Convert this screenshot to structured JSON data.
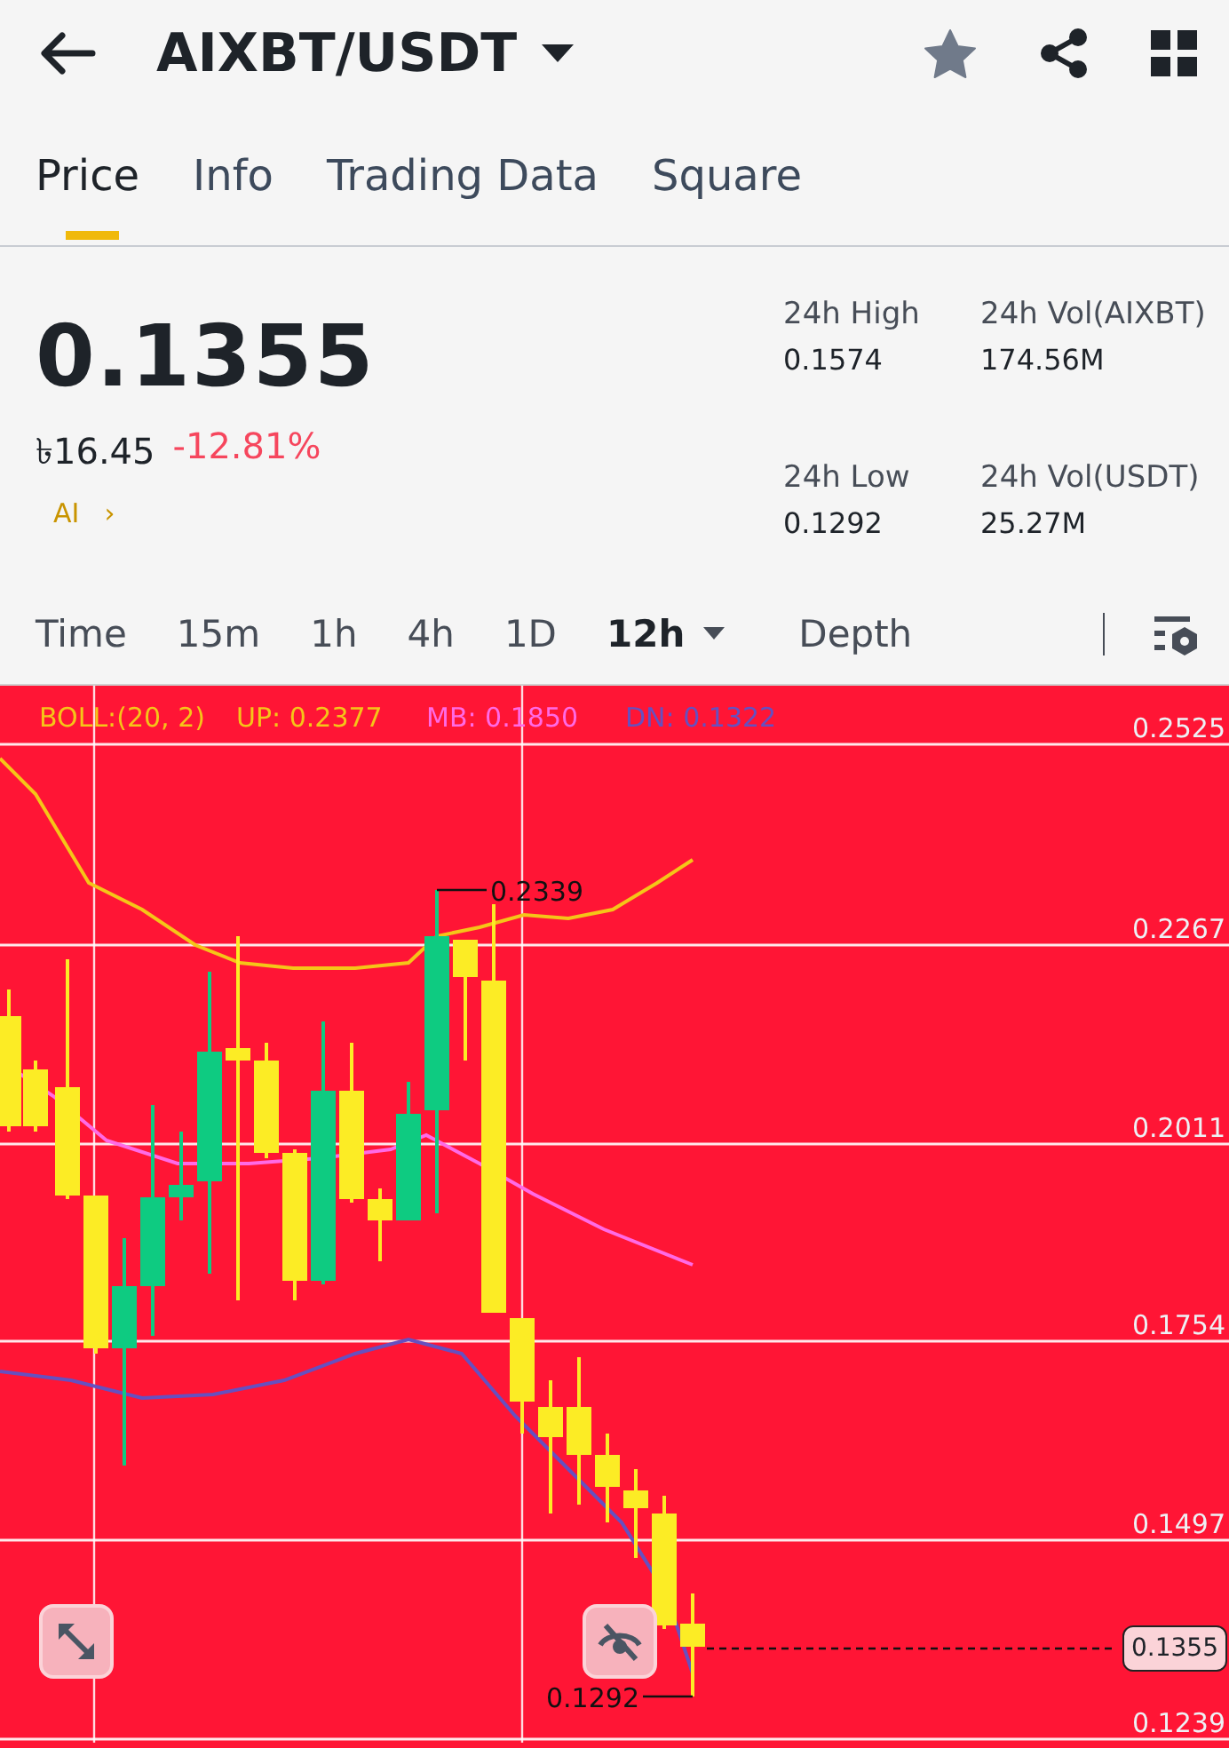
{
  "header": {
    "title": "AIXBT/USDT"
  },
  "tabs": [
    {
      "label": "Price",
      "selected": true
    },
    {
      "label": "Info",
      "selected": false
    },
    {
      "label": "Trading Data",
      "selected": false
    },
    {
      "label": "Square",
      "selected": false
    }
  ],
  "price": {
    "last": "0.1355",
    "fiat": "৳16.45",
    "change": "-12.81%",
    "tag": "AI",
    "tag_arrow": "›"
  },
  "stats": [
    {
      "label": "24h High",
      "value": "0.1574"
    },
    {
      "label": "24h Vol(AIXBT)",
      "value": "174.56M"
    },
    {
      "label": "24h Low",
      "value": "0.1292"
    },
    {
      "label": "24h Vol(USDT)",
      "value": "25.27M"
    }
  ],
  "intervals": [
    {
      "label": "Time",
      "kind": "option",
      "selected": false
    },
    {
      "label": "15m",
      "kind": "option",
      "selected": false
    },
    {
      "label": "1h",
      "kind": "option",
      "selected": false
    },
    {
      "label": "4h",
      "kind": "option",
      "selected": false
    },
    {
      "label": "1D",
      "kind": "option",
      "selected": false
    },
    {
      "label": "12h",
      "kind": "dropdown",
      "selected": true
    },
    {
      "label": "Depth",
      "kind": "option",
      "selected": false
    }
  ],
  "chart": {
    "indicator": "BOLL:(20, 2)",
    "bands": [
      {
        "label": "UP: 0.2377",
        "color": "#f5c518"
      },
      {
        "label": "MB: 0.1850",
        "color": "#ff6ae6"
      },
      {
        "label": "DN: 0.1322",
        "color": "#6650c0"
      }
    ],
    "axis_labels": [
      "0.2525",
      "0.2267",
      "0.2011",
      "0.1754",
      "0.1497",
      "0.1239"
    ],
    "high_label": "0.2339",
    "low_label": "0.1292",
    "last_price": "0.1355"
  }
}
